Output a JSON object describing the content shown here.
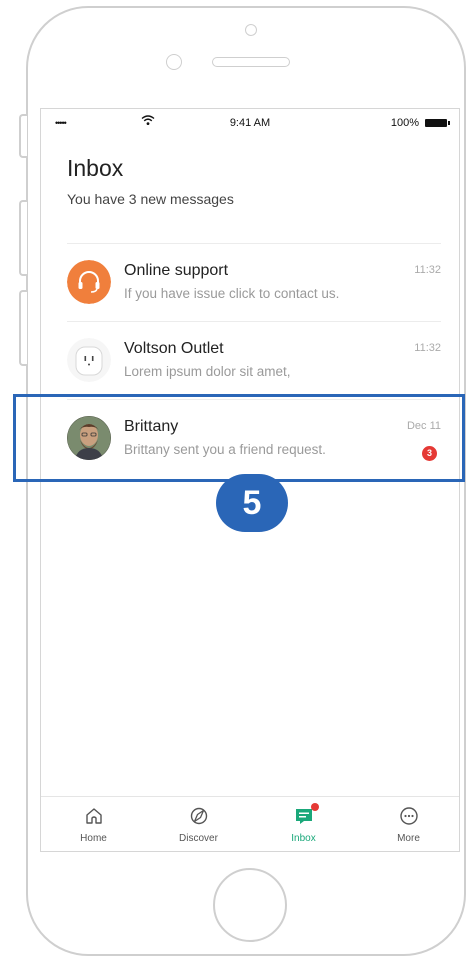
{
  "status_bar": {
    "signal": "•••••",
    "time": "9:41 AM",
    "battery": "100%"
  },
  "header": {
    "title": "Inbox",
    "subtitle": "You have 3 new messages"
  },
  "messages": [
    {
      "sender": "Online support",
      "preview": "If you have  issue click to contact us.",
      "time": "11:32",
      "avatar_icon": "headset-icon",
      "avatar_color": "#f07f3c"
    },
    {
      "sender": "Voltson Outlet",
      "preview": "Lorem ipsum dolor sit amet,",
      "time": "11:32",
      "avatar_icon": "smart-plug-icon"
    },
    {
      "sender": "Brittany",
      "preview": "Brittany sent you a friend request.",
      "time": "Dec 11",
      "badge": "3",
      "avatar_icon": "user-photo"
    }
  ],
  "tabs": [
    {
      "label": "Home",
      "icon": "home-icon"
    },
    {
      "label": "Discover",
      "icon": "compass-icon"
    },
    {
      "label": "Inbox",
      "icon": "inbox-icon",
      "active": true
    },
    {
      "label": "More",
      "icon": "more-icon"
    }
  ],
  "callout": {
    "step": "5",
    "color": "#2a66b7"
  },
  "colors": {
    "accent": "#1aa87a",
    "badge": "#e53935",
    "support_orange": "#f07f3c"
  }
}
